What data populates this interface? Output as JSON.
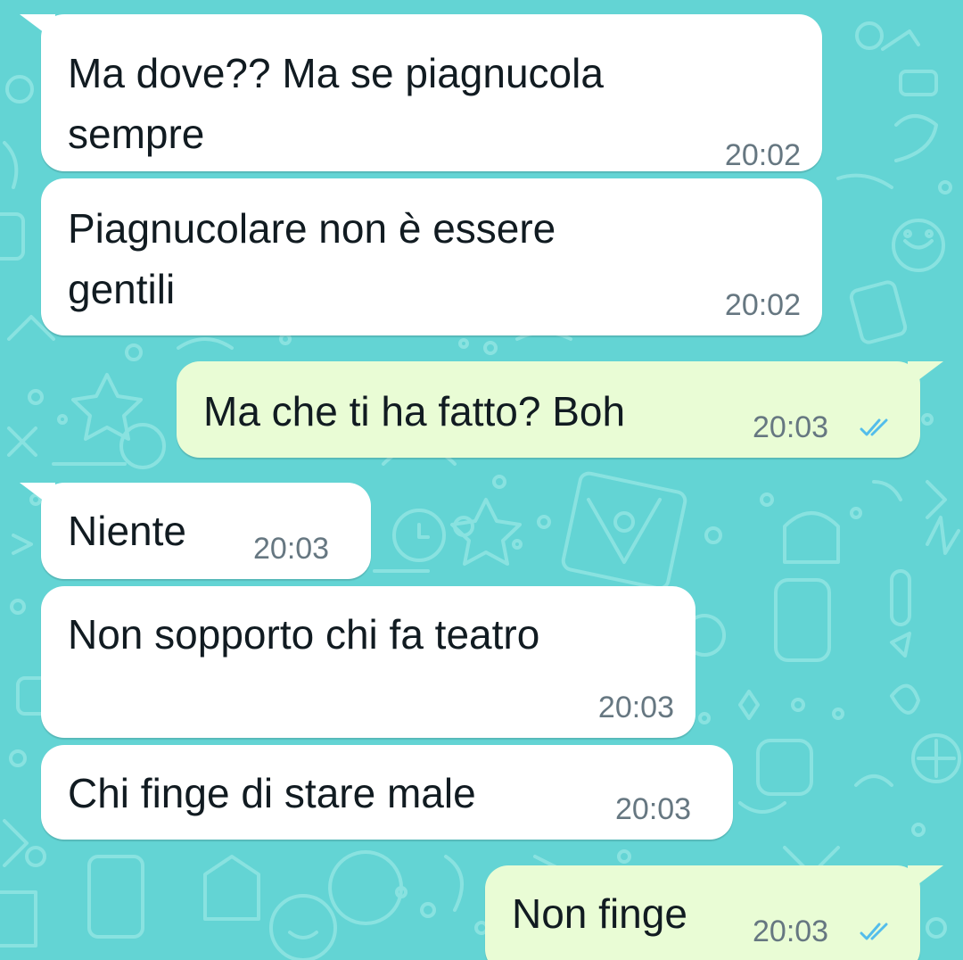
{
  "colors": {
    "wallpaper": "#63d4d4",
    "wallpaper_doodle": "#8ee4e2",
    "incoming_bubble": "#ffffff",
    "outgoing_bubble": "#e9fcd5",
    "timestamp": "#667781",
    "read_ticks": "#53bdeb",
    "text": "#111b21"
  },
  "messages": [
    {
      "direction": "incoming",
      "text": "Ma dove?? Ma se piagnucola\nsempre",
      "time": "20:02"
    },
    {
      "direction": "incoming",
      "text": "Piagnucolare non è essere\ngentili",
      "time": "20:02"
    },
    {
      "direction": "outgoing",
      "text": "Ma che ti ha fatto? Boh",
      "time": "20:03",
      "status_icon": "double-check-read-icon"
    },
    {
      "direction": "incoming",
      "text": "Niente",
      "time": "20:03"
    },
    {
      "direction": "incoming",
      "text": "Non sopporto chi fa teatro",
      "time": "20:03"
    },
    {
      "direction": "incoming",
      "text": "Chi finge di stare male",
      "time": "20:03"
    },
    {
      "direction": "outgoing",
      "text": "Non finge",
      "time": "20:03",
      "status_icon": "double-check-read-icon"
    }
  ]
}
